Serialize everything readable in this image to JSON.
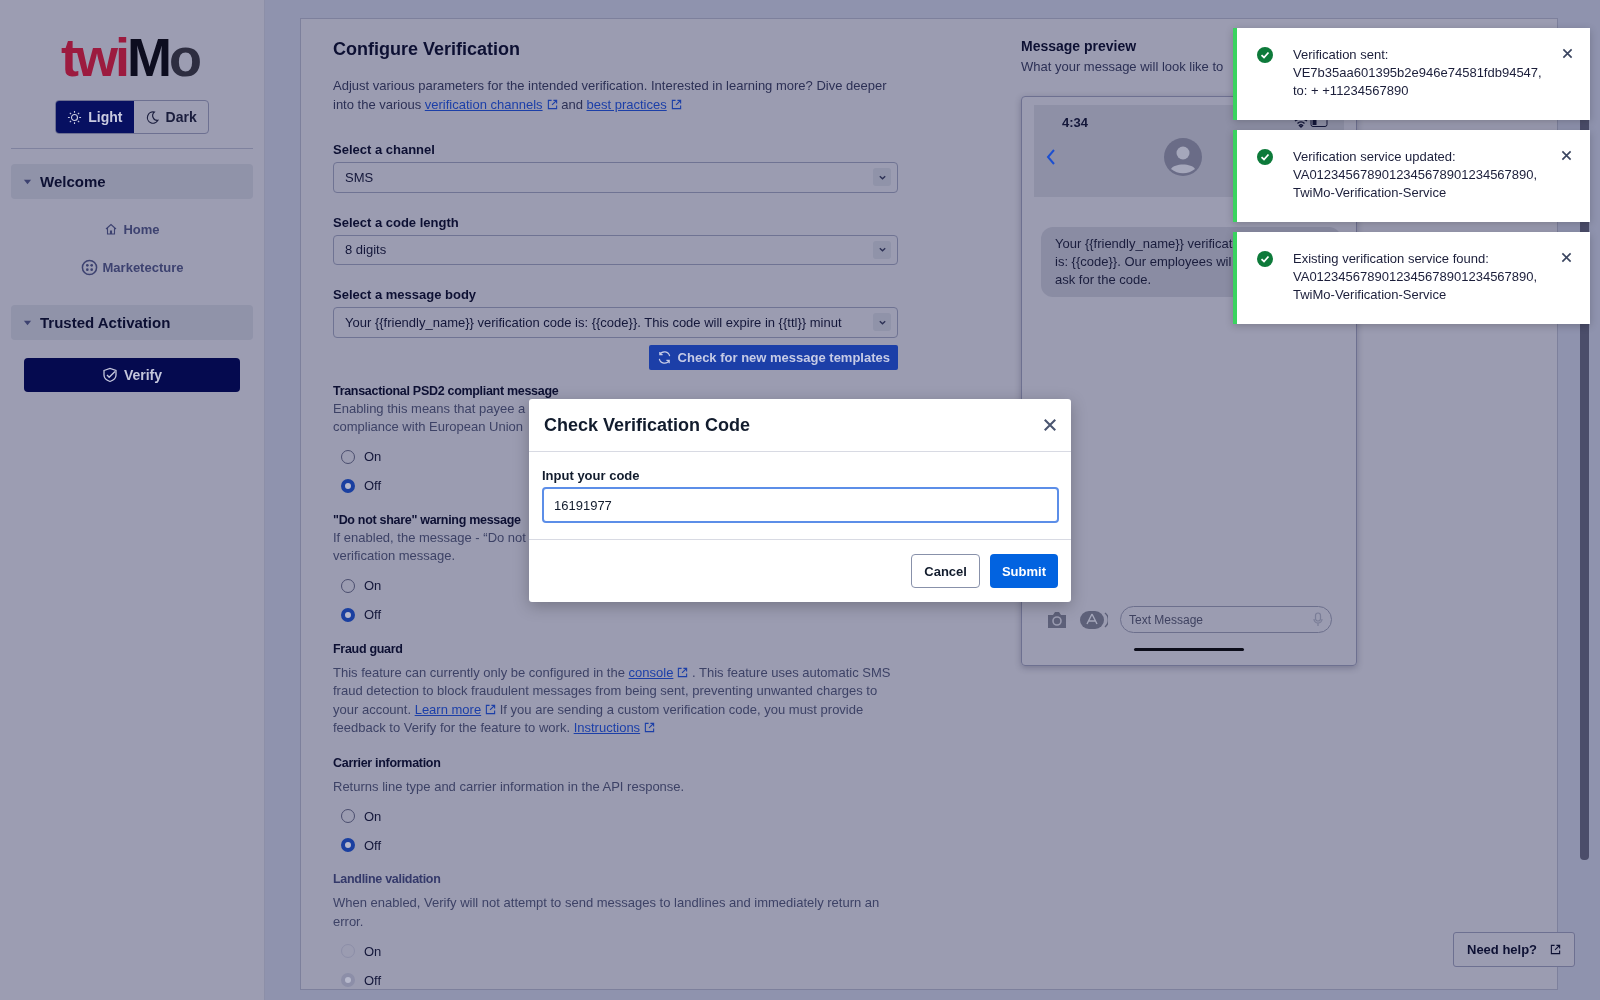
{
  "sidebar": {
    "logo": [
      "twi",
      "M",
      "o"
    ],
    "theme_toggle": [
      {
        "label": "Light",
        "selected": true
      },
      {
        "label": "Dark",
        "selected": false
      }
    ],
    "groups": [
      {
        "title": "Welcome",
        "expanded": true,
        "items": [
          {
            "label": "Home",
            "selected": false
          },
          {
            "label": "Marketecture",
            "selected": false
          }
        ]
      },
      {
        "title": "Trusted Activation",
        "expanded": true,
        "items": [
          {
            "label": "Verify",
            "selected": true
          }
        ]
      }
    ]
  },
  "configure": {
    "title": "Configure Verification",
    "intro": [
      {
        "kind": "text",
        "text": "Adjust various parameters for the intended verification. Interested in learning more? Dive deeper into the various "
      },
      {
        "kind": "link",
        "text": "verification channels"
      },
      {
        "kind": "text",
        "text": " and "
      },
      {
        "kind": "link",
        "text": "best practices"
      }
    ],
    "selects": [
      {
        "label": "Select a channel",
        "value": "SMS"
      },
      {
        "label": "Select a code length",
        "value": "8 digits"
      },
      {
        "label": "Select a message body",
        "value": "Your {{friendly_name}} verification code is: {{code}}. This code will expire in {{ttl}} minut"
      }
    ],
    "template_button": "Check for new message templates",
    "sections": [
      {
        "title": "Transactional PSD2 compliant message",
        "disabled": false,
        "description": [
          {
            "kind": "lines",
            "lines": [
              "Enabling this means that payee a",
              "compliance with European Union"
            ]
          }
        ],
        "options": [
          {
            "label": "On",
            "selected": false
          },
          {
            "label": "Off",
            "selected": true
          }
        ]
      },
      {
        "title": "\"Do not share\" warning message",
        "disabled": false,
        "description": [
          {
            "kind": "lines",
            "lines": [
              "If enabled, the message - “Do not",
              "verification message."
            ]
          }
        ],
        "options": [
          {
            "label": "On",
            "selected": false
          },
          {
            "label": "Off",
            "selected": true
          }
        ]
      },
      {
        "title": "Fraud guard",
        "disabled": false,
        "description": [
          {
            "kind": "text",
            "text": "This feature can currently only be configured in the "
          },
          {
            "kind": "link",
            "text": "console"
          },
          {
            "kind": "text",
            "text": " . This feature uses automatic SMS fraud detection to block fraudulent messages from being sent, preventing unwanted charges to your account. "
          },
          {
            "kind": "link",
            "text": "Learn more"
          },
          {
            "kind": "text",
            "text": " If you are sending a custom verification code, you must provide feedback to Verify for the feature to work. "
          },
          {
            "kind": "link",
            "text": "Instructions"
          }
        ]
      },
      {
        "title": "Carrier information",
        "disabled": false,
        "description": [
          {
            "kind": "text",
            "text": "Returns line type and carrier information in the API response."
          }
        ],
        "options": [
          {
            "label": "On",
            "selected": false
          },
          {
            "label": "Off",
            "selected": true
          }
        ]
      },
      {
        "title": "Landline validation",
        "disabled": true,
        "description": [
          {
            "kind": "text",
            "text": "When enabled, Verify will not attempt to send messages to landlines and immediately return an error."
          }
        ],
        "options": [
          {
            "label": "On",
            "selected": false
          },
          {
            "label": "Off",
            "selected": true
          }
        ]
      }
    ]
  },
  "preview": {
    "title": "Message preview",
    "subtitle": "What your message will look like to",
    "time": "4:34",
    "bubble_lines": [
      "Your {{friendly_name}} verificat",
      "is: {{code}}. Our employees wil",
      "ask for the code."
    ],
    "input_placeholder": "Text Message"
  },
  "modal": {
    "title": "Check Verification Code",
    "field_label": "Input your code",
    "field_value": "16191977",
    "buttons": [
      {
        "label": "Cancel",
        "kind": "secondary"
      },
      {
        "label": "Submit",
        "kind": "primary"
      }
    ]
  },
  "toasts": [
    {
      "lines": [
        "Verification sent:",
        "VE7b35aa601395b2e946e74581fdb94547,",
        "to: + +11234567890"
      ]
    },
    {
      "lines": [
        "Verification service updated:",
        "VA0123456789012345678901234567890,",
        "TwiMo-Verification-Service"
      ]
    },
    {
      "lines": [
        "Existing verification service found:",
        "VA0123456789012345678901234567890,",
        "TwiMo-Verification-Service"
      ]
    }
  ],
  "help_button": "Need help?"
}
